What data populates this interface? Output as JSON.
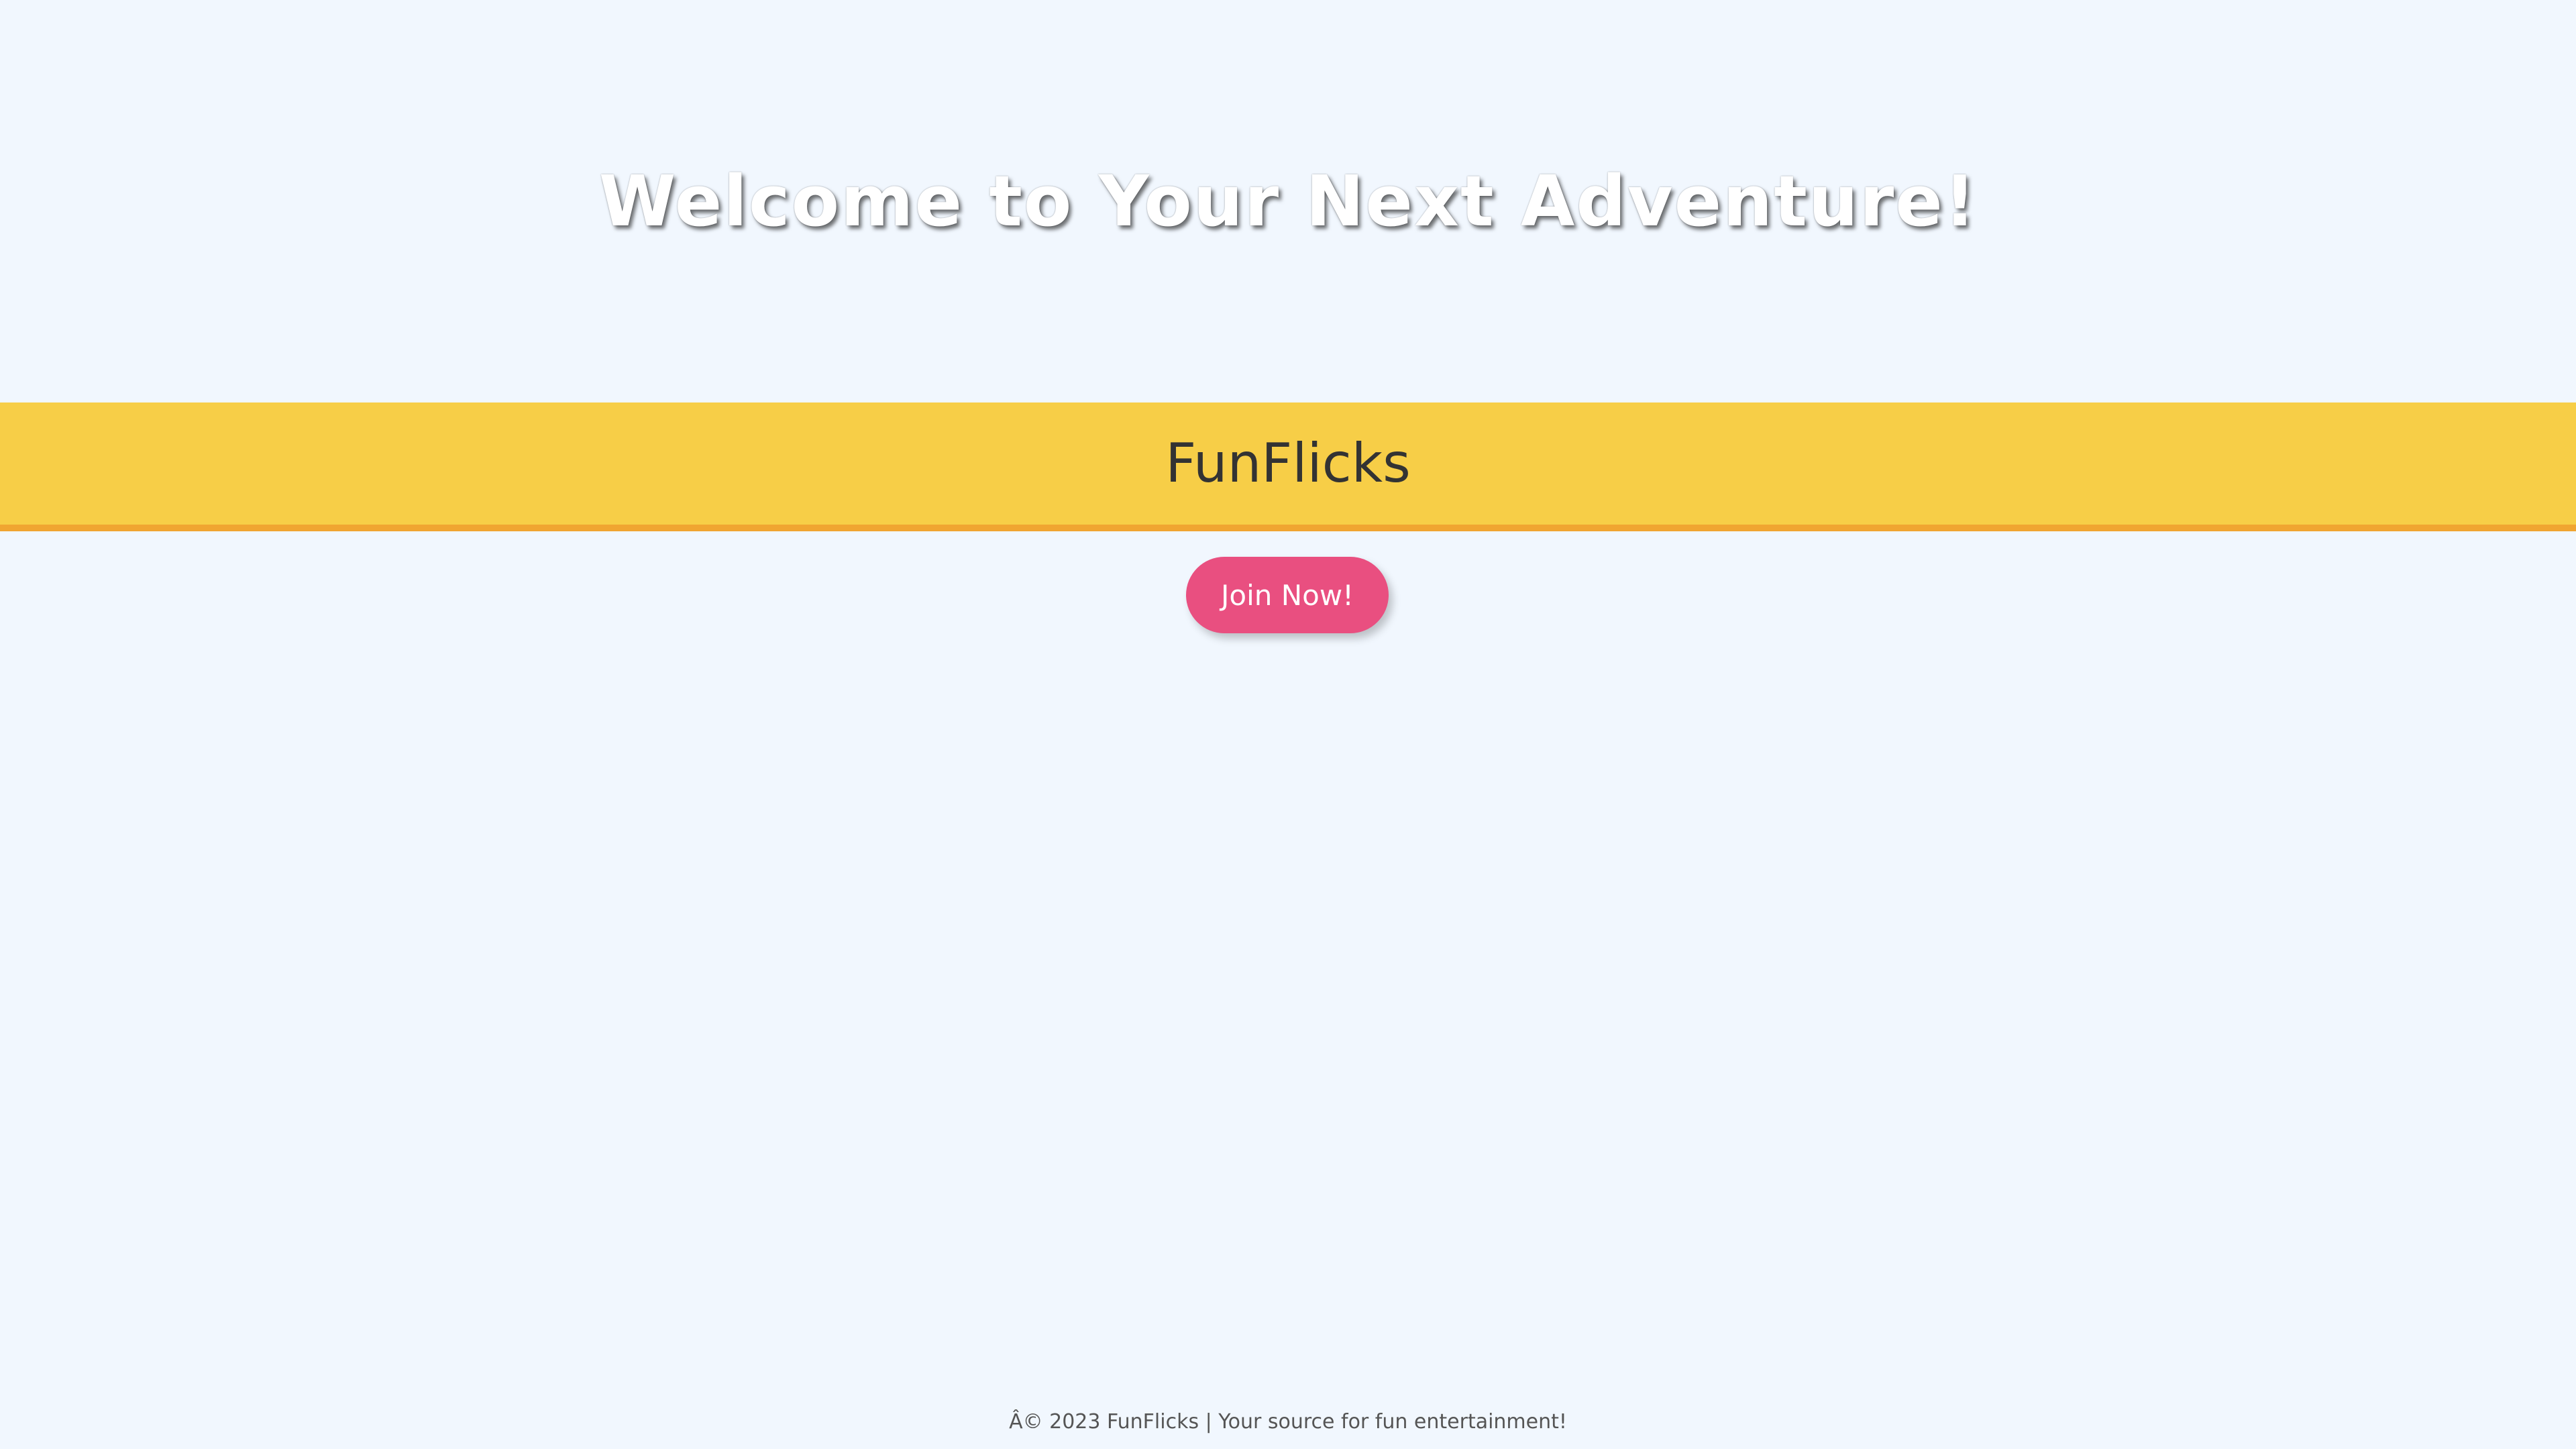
{
  "hero": {
    "title": "Welcome to Your Next Adventure!"
  },
  "header": {
    "brand": "FunFlicks"
  },
  "cta": {
    "join_label": "Join Now!"
  },
  "footer": {
    "text": "Â© 2023 FunFlicks | Your source for fun entertainment!"
  },
  "colors": {
    "background": "#f1f7fe",
    "brand_bar": "#f7ce47",
    "brand_bar_border": "#f0a531",
    "button": "#e94f80",
    "button_text": "#ffffff",
    "hero_text": "#ffffff"
  }
}
